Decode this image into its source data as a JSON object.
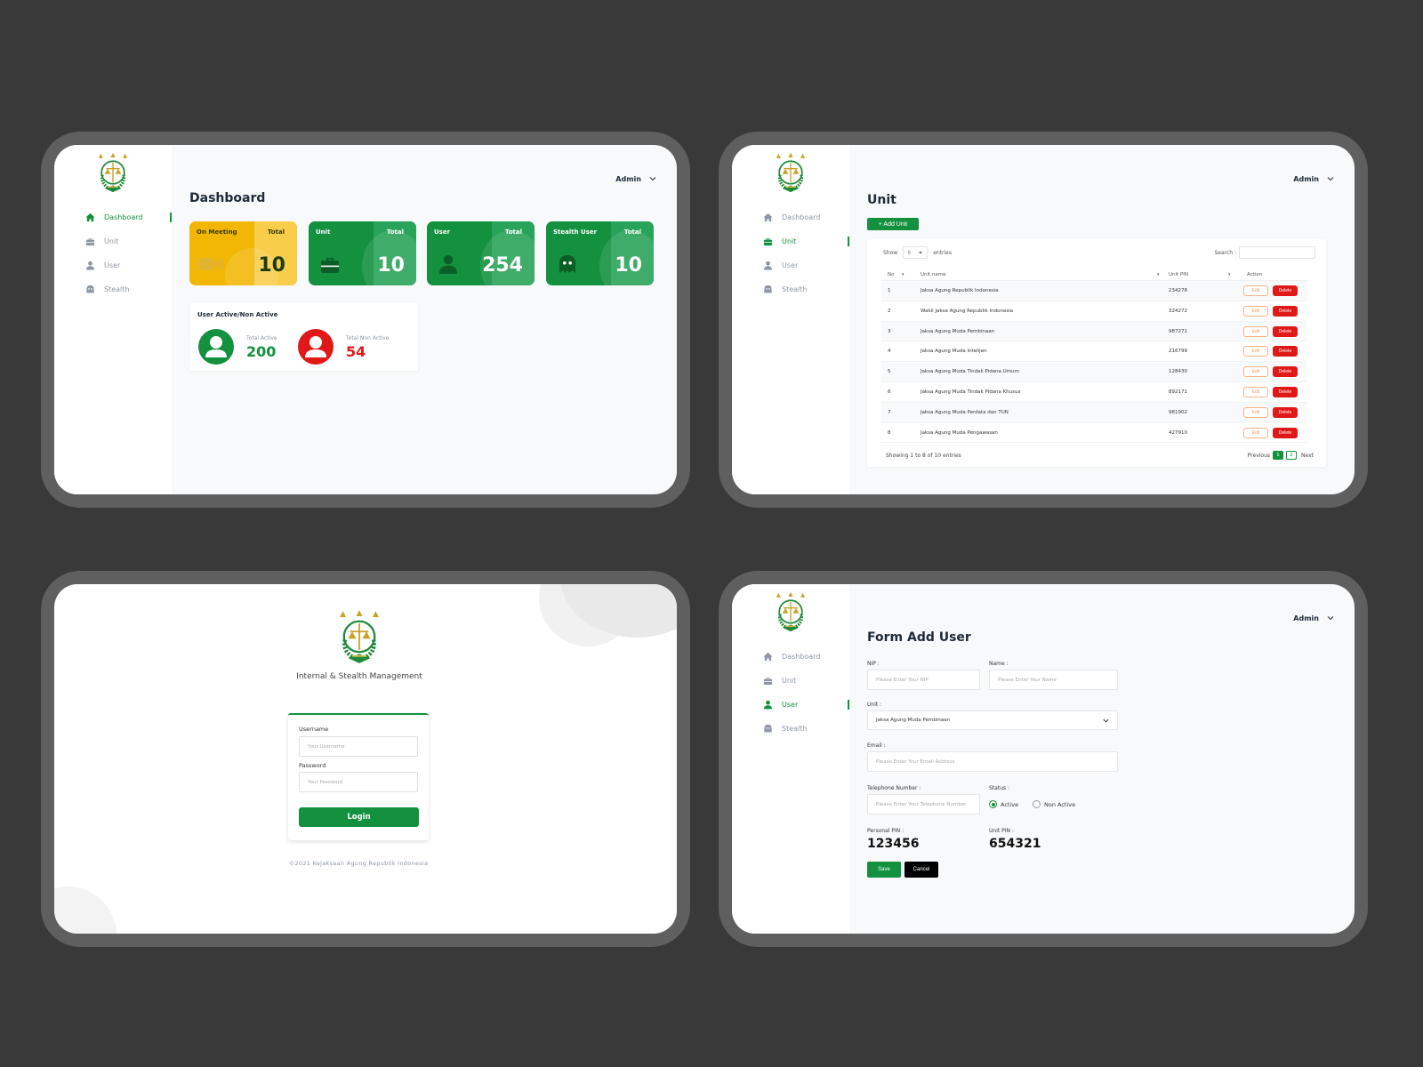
{
  "colors": {
    "brand_green": "#13913f",
    "danger_red": "#e11818",
    "yellow": "#f2b705",
    "background": "#393939"
  },
  "sidebar": {
    "items": [
      {
        "label": "Dashboard",
        "icon": "home-icon"
      },
      {
        "label": "Unit",
        "icon": "briefcase-icon"
      },
      {
        "label": "User",
        "icon": "user-icon"
      },
      {
        "label": "Stealth",
        "icon": "ghost-icon"
      }
    ]
  },
  "header": {
    "user_label": "Admin"
  },
  "dashboard": {
    "title": "Dashboard",
    "cards": [
      {
        "label": "On Meeting",
        "total_label": "Total",
        "value": "10",
        "icon": "video-camera-icon",
        "color": "#f2b705"
      },
      {
        "label": "Unit",
        "total_label": "Total",
        "value": "10",
        "icon": "briefcase-icon",
        "color": "#13913f"
      },
      {
        "label": "User",
        "total_label": "Total",
        "value": "254",
        "icon": "user-icon",
        "color": "#13913f"
      },
      {
        "label": "Stealth User",
        "total_label": "Total",
        "value": "10",
        "icon": "ghost-icon",
        "color": "#13913f"
      }
    ],
    "user_activity": {
      "title": "User Active/Non Active",
      "active_label": "Total Active",
      "active_value": "200",
      "inactive_label": "Total Non Active",
      "inactive_value": "54"
    }
  },
  "unit_page": {
    "title": "Unit",
    "add_button": "+ Add Unit",
    "show_label": "Show",
    "entries_value": "8",
    "entries_label": "entries",
    "search_label": "Search :",
    "columns": [
      "No",
      "Unit name",
      "Unit PIN",
      "Action"
    ],
    "rows": [
      {
        "no": "1",
        "name": "Jaksa Agung Republik Indonesia",
        "pin": "234278"
      },
      {
        "no": "2",
        "name": "Wakil Jaksa Agung Republik Indonesia",
        "pin": "324272"
      },
      {
        "no": "3",
        "name": "Jaksa Agung Muda Pembinaan",
        "pin": "987271"
      },
      {
        "no": "4",
        "name": "Jaksa Agung Muda Intelijen",
        "pin": "216799"
      },
      {
        "no": "5",
        "name": "Jaksa Agung Muda Tindak Pidana Umum",
        "pin": "128430"
      },
      {
        "no": "6",
        "name": "Jaksa Agung Muda Tindak Pidana Khusus",
        "pin": "892171"
      },
      {
        "no": "7",
        "name": "Jaksa Agung Muda Perdata dan TUN",
        "pin": "981902"
      },
      {
        "no": "8",
        "name": "Jaksa Agung Muda Pengawasan",
        "pin": "427910"
      }
    ],
    "edit_label": "Edit",
    "delete_label": "Delete",
    "footer_text": "Showing 1 to 8 of 10 entries",
    "pager": {
      "previous": "Previous",
      "pages": [
        "1",
        "2"
      ],
      "next": "Next"
    }
  },
  "login": {
    "app_name": "Internal & Stealth Management",
    "username_label": "Username",
    "username_placeholder": "Your Username",
    "password_label": "Password",
    "password_placeholder": "Your Password",
    "login_button": "Login",
    "copyright": "©2021 Kejaksaan Agung Republik Indonesia"
  },
  "form": {
    "title": "Form Add User",
    "nip_label": "NIP :",
    "nip_placeholder": "Please Enter Your NIP",
    "name_label": "Name :",
    "name_placeholder": "Please Enter Your Name",
    "unit_label": "Unit :",
    "unit_value": "Jaksa Agung Muda Pembinaan",
    "email_label": "Email :",
    "email_placeholder": "Please Enter Your Email Address",
    "phone_label": "Telephone Number :",
    "phone_placeholder": "Please Enter Your Telephone Number",
    "status_label": "Status :",
    "status_active": "Active",
    "status_inactive": "Non Active",
    "personal_pin_label": "Personal PIN :",
    "personal_pin_value": "123456",
    "unit_pin_label": "Unit PIN :",
    "unit_pin_value": "654321",
    "save_button": "Save",
    "cancel_button": "Cancel"
  }
}
